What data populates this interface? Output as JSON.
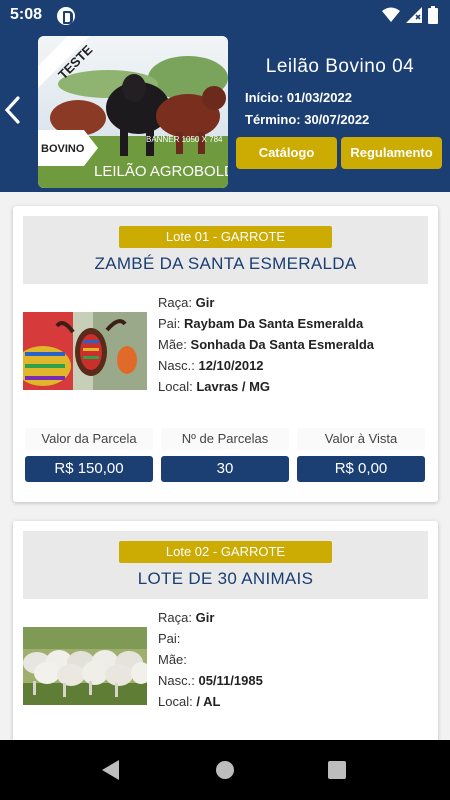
{
  "status": {
    "time": "5:08"
  },
  "header": {
    "title": "Leilão Bovino 04",
    "start_date": "Início: 01/03/2022",
    "end_date": "Término: 30/07/2022",
    "catalog_label": "Catálogo",
    "rules_label": "Regulamento",
    "banner": {
      "ribbon_text": "TESTE",
      "side_text": "BOVINO",
      "size_text": "BANNER 1050 X 784",
      "brand_text": "LEILÃO AGROBOLD"
    }
  },
  "lots": [
    {
      "badge": "Lote 01 - GARROTE",
      "name": "ZAMBÉ DA SANTA ESMERALDA",
      "breed_label": "Raça:",
      "breed": "Gir",
      "sire_label": "Pai:",
      "sire": "Raybam Da Santa Esmeralda",
      "dam_label": "Mãe:",
      "dam": "Sonhada Da Santa Esmeralda",
      "birth_label": "Nasc.:",
      "birth": "12/10/2012",
      "location_label": "Local:",
      "location": "Lavras / MG",
      "installment_value_label": "Valor da Parcela",
      "installment_value": "R$ 150,00",
      "installments_label": "Nº de Parcelas",
      "installments": "30",
      "cash_value_label": "Valor à Vista",
      "cash_value": "R$ 0,00"
    },
    {
      "badge": "Lote 02 - GARROTE",
      "name": "LOTE DE 30 ANIMAIS",
      "breed_label": "Raça:",
      "breed": "Gir",
      "sire_label": "Pai:",
      "sire": "",
      "dam_label": "Mãe:",
      "dam": "",
      "birth_label": "Nasc.:",
      "birth": "05/11/1985",
      "location_label": "Local:",
      "location": " / AL"
    }
  ],
  "colors": {
    "primary": "#1b3e73",
    "accent": "#ccab02"
  }
}
